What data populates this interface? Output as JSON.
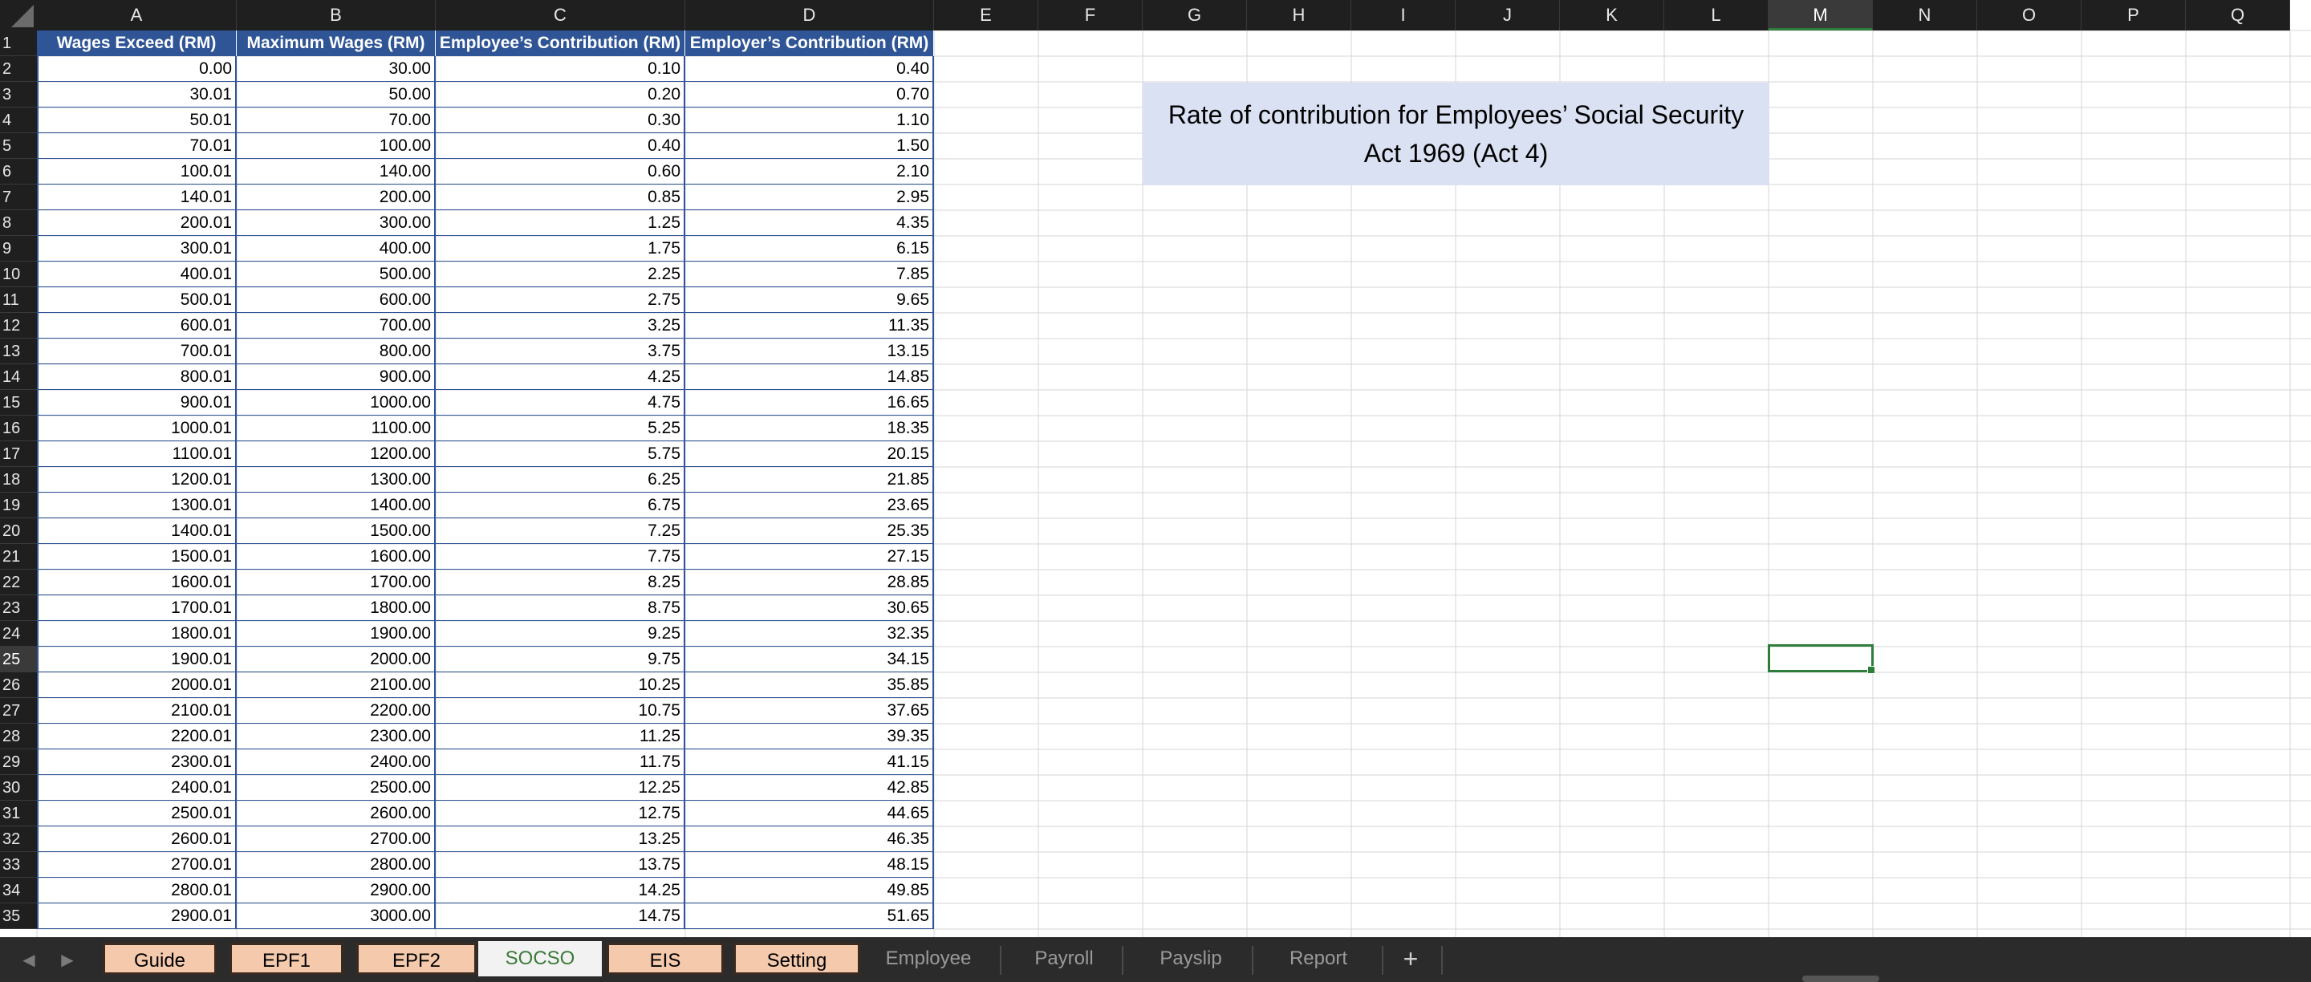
{
  "sheet": {
    "columns": [
      "A",
      "B",
      "C",
      "D",
      "E",
      "F",
      "G",
      "H",
      "I",
      "J",
      "K",
      "L",
      "M",
      "N",
      "O",
      "P",
      "Q"
    ],
    "selected_column": "M",
    "selected_row": 25,
    "row_numbers": [
      1,
      2,
      3,
      4,
      5,
      6,
      7,
      8,
      9,
      10,
      11,
      12,
      13,
      14,
      15,
      16,
      17,
      18,
      19,
      20,
      21,
      22,
      23,
      24,
      25,
      26,
      27,
      28,
      29,
      30,
      31,
      32,
      33,
      34,
      35
    ],
    "table": {
      "headers": [
        "Wages Exceed (RM)",
        "Maximum Wages (RM)",
        "Employee’s Contribution (RM)",
        "Employer’s Contribution (RM)"
      ],
      "rows": [
        [
          "0.00",
          "30.00",
          "0.10",
          "0.40"
        ],
        [
          "30.01",
          "50.00",
          "0.20",
          "0.70"
        ],
        [
          "50.01",
          "70.00",
          "0.30",
          "1.10"
        ],
        [
          "70.01",
          "100.00",
          "0.40",
          "1.50"
        ],
        [
          "100.01",
          "140.00",
          "0.60",
          "2.10"
        ],
        [
          "140.01",
          "200.00",
          "0.85",
          "2.95"
        ],
        [
          "200.01",
          "300.00",
          "1.25",
          "4.35"
        ],
        [
          "300.01",
          "400.00",
          "1.75",
          "6.15"
        ],
        [
          "400.01",
          "500.00",
          "2.25",
          "7.85"
        ],
        [
          "500.01",
          "600.00",
          "2.75",
          "9.65"
        ],
        [
          "600.01",
          "700.00",
          "3.25",
          "11.35"
        ],
        [
          "700.01",
          "800.00",
          "3.75",
          "13.15"
        ],
        [
          "800.01",
          "900.00",
          "4.25",
          "14.85"
        ],
        [
          "900.01",
          "1000.00",
          "4.75",
          "16.65"
        ],
        [
          "1000.01",
          "1100.00",
          "5.25",
          "18.35"
        ],
        [
          "1100.01",
          "1200.00",
          "5.75",
          "20.15"
        ],
        [
          "1200.01",
          "1300.00",
          "6.25",
          "21.85"
        ],
        [
          "1300.01",
          "1400.00",
          "6.75",
          "23.65"
        ],
        [
          "1400.01",
          "1500.00",
          "7.25",
          "25.35"
        ],
        [
          "1500.01",
          "1600.00",
          "7.75",
          "27.15"
        ],
        [
          "1600.01",
          "1700.00",
          "8.25",
          "28.85"
        ],
        [
          "1700.01",
          "1800.00",
          "8.75",
          "30.65"
        ],
        [
          "1800.01",
          "1900.00",
          "9.25",
          "32.35"
        ],
        [
          "1900.01",
          "2000.00",
          "9.75",
          "34.15"
        ],
        [
          "2000.01",
          "2100.00",
          "10.25",
          "35.85"
        ],
        [
          "2100.01",
          "2200.00",
          "10.75",
          "37.65"
        ],
        [
          "2200.01",
          "2300.00",
          "11.25",
          "39.35"
        ],
        [
          "2300.01",
          "2400.00",
          "11.75",
          "41.15"
        ],
        [
          "2400.01",
          "2500.00",
          "12.25",
          "42.85"
        ],
        [
          "2500.01",
          "2600.00",
          "12.75",
          "44.65"
        ],
        [
          "2600.01",
          "2700.00",
          "13.25",
          "46.35"
        ],
        [
          "2700.01",
          "2800.00",
          "13.75",
          "48.15"
        ],
        [
          "2800.01",
          "2900.00",
          "14.25",
          "49.85"
        ],
        [
          "2900.01",
          "3000.00",
          "14.75",
          "51.65"
        ]
      ]
    },
    "note": {
      "line1": "Rate of contribution for Employees’ Social Security",
      "line2": "Act 1969 (Act 4)"
    }
  },
  "tabs": {
    "items": [
      {
        "label": "Guide",
        "style": "colored"
      },
      {
        "label": "EPF1",
        "style": "colored"
      },
      {
        "label": "EPF2",
        "style": "colored"
      },
      {
        "label": "SOCSO",
        "style": "active"
      },
      {
        "label": "EIS",
        "style": "colored"
      },
      {
        "label": "Setting",
        "style": "colored"
      },
      {
        "label": "Employee",
        "style": "plain"
      },
      {
        "label": "Payroll",
        "style": "plain"
      },
      {
        "label": "Payslip",
        "style": "plain"
      },
      {
        "label": "Report",
        "style": "plain"
      }
    ],
    "add_label": "+",
    "prev_icon": "triangle-left-icon",
    "next_icon": "triangle-right-icon"
  },
  "colors": {
    "header_fill": "#2f5597",
    "note_fill": "#d9e1f2",
    "tab_fill": "#f4c9ac",
    "active_tab_text": "#3a7a3a",
    "selection": "#2f7d3b"
  }
}
